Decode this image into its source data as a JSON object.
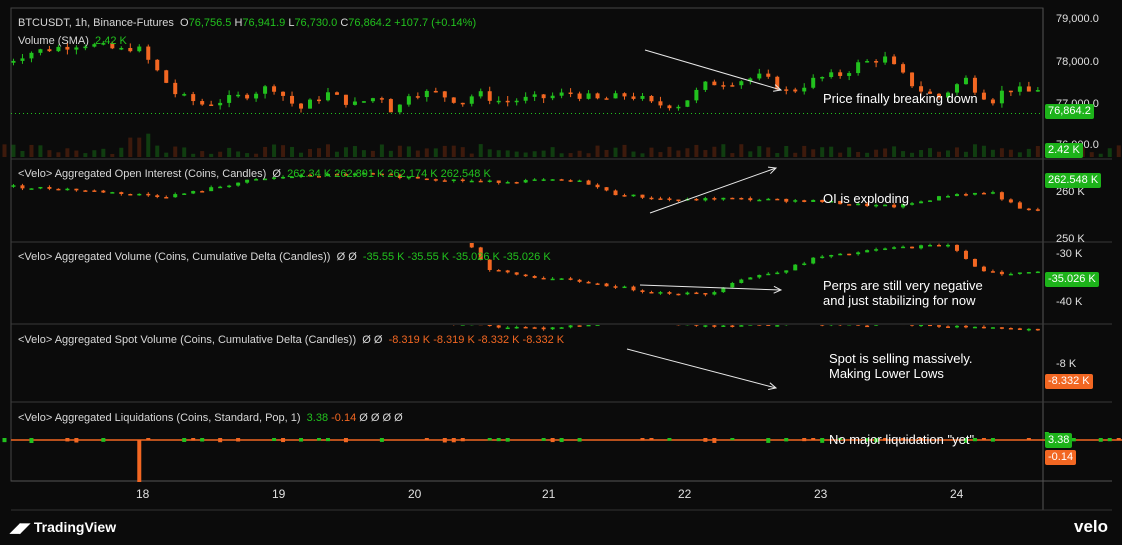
{
  "header": {
    "symbol": "BTCUSDT, 1h, Binance-Futures",
    "o_label": "O",
    "o_value": "76,756.5",
    "h_label": "H",
    "h_value": "76,941.9",
    "l_label": "L",
    "l_value": "76,730.0",
    "c_label": "C",
    "c_value": "76,864.2",
    "change": "+107.7 (+0.14%)",
    "volume_label": "Volume (SMA)",
    "volume_value": "2.42 K"
  },
  "panes": {
    "oi": {
      "title": "<Velo> Aggregated Open Interest (Coins, Candles)",
      "symbol": "Ø",
      "values": [
        "262.34 K",
        "262.891 K",
        "262.174 K",
        "262.548 K"
      ]
    },
    "perp": {
      "title": "<Velo> Aggregated Volume (Coins, Cumulative Delta (Candles))",
      "symbols": "Ø Ø",
      "values": [
        "-35.55 K",
        "-35.55 K",
        "-35.026 K",
        "-35.026 K"
      ]
    },
    "spot": {
      "title": "<Velo> Aggregated Spot Volume (Coins, Cumulative Delta (Candles))",
      "symbols": "Ø Ø",
      "values": [
        "-8.319 K",
        "-8.319 K",
        "-8.332 K",
        "-8.332 K"
      ]
    },
    "liq": {
      "title": "<Velo> Aggregated Liquidations (Coins, Standard, Pop, 1)",
      "v1": "3.38",
      "v2": "-0.14",
      "symbols": "Ø Ø Ø Ø"
    }
  },
  "annotations": {
    "price": "Price finally breaking down",
    "oi": "OI is exploding",
    "perp_line1": "Perps are still very negative",
    "perp_line2": "and just stabilizing for now",
    "spot_line1": "Spot is selling massively.",
    "spot_line2": "Making Lower Lows",
    "liq": "No major liquidation \"yet\""
  },
  "axis": {
    "price_ticks": [
      "79,000.0",
      "78,000.0",
      "77,000.0",
      "76,000.0"
    ],
    "price_tag": "76,864.2",
    "volume_tag": "2.42 K",
    "oi_ticks": [
      "260 K",
      "250 K"
    ],
    "oi_tag": "262.548 K",
    "perp_ticks": [
      "-30 K",
      "-40 K"
    ],
    "perp_tag": "-35.026 K",
    "spot_ticks": [
      "-8 K"
    ],
    "spot_tag": "-8.332 K",
    "liq_tag_pos": "3.38",
    "liq_tag_neg": "-0.14"
  },
  "brand": {
    "left": "TradingView",
    "right": "velo"
  },
  "colors": {
    "up": "#22c11e",
    "down": "#f26722",
    "background": "#0b0b0b",
    "grid": "#2a2a2a"
  },
  "chart_data": [
    {
      "type": "candlestick",
      "title": "BTCUSDT, 1h, Binance-Futures",
      "x_ticks": [
        "18",
        "19",
        "20",
        "21",
        "22",
        "23",
        "24"
      ],
      "ylim": [
        75900,
        79100
      ],
      "last": 76864.2,
      "path_days": [
        0,
        0.2,
        0.4,
        0.6,
        0.9,
        1.0,
        1.3,
        1.5,
        1.8,
        2.0,
        2.2,
        2.4,
        2.6,
        2.8,
        2.9,
        3.0,
        3.2,
        3.4,
        3.5,
        3.7,
        3.8,
        4.0,
        4.2,
        4.4,
        4.6,
        4.7,
        4.8,
        5.0,
        5.2,
        5.4,
        5.6,
        5.8,
        6.0,
        6.2,
        6.3,
        6.5,
        6.7,
        6.8,
        6.9,
        7.0,
        7.1,
        7.2,
        7.3,
        7.4,
        7.6,
        7.7,
        7.85,
        8.0,
        8.15,
        8.3,
        8.5,
        8.65,
        8.8,
        8.95,
        9.1,
        9.2,
        9.25
      ],
      "path_values": [
        77900,
        78150,
        78250,
        78350,
        78200,
        78300,
        77250,
        77050,
        77250,
        77450,
        76950,
        77300,
        77050,
        77250,
        76850,
        77300,
        77300,
        77100,
        77300,
        77100,
        77150,
        77200,
        77300,
        77150,
        77250,
        77200,
        77050,
        77050,
        77500,
        77550,
        77650,
        77300,
        77600,
        77700,
        77900,
        78050,
        77500,
        77300,
        77200,
        77400,
        77600,
        77300,
        77150,
        77400,
        77300,
        77600,
        77550,
        77300,
        77250,
        77550,
        77950,
        77800,
        77700,
        77500,
        77600,
        76850,
        76864
      ]
    },
    {
      "type": "line",
      "title": "<Velo> Aggregated Open Interest (Coins, Candles)",
      "ylim": [
        249000,
        265000
      ],
      "last": 262548,
      "path_days": [
        0,
        0.5,
        1.0,
        1.2,
        1.4,
        1.8,
        2.1,
        2.4,
        2.7,
        3.0,
        3.3,
        3.6,
        4.0,
        4.3,
        4.5,
        4.8,
        5.0,
        5.3,
        5.7,
        6.0,
        6.3,
        6.6,
        7.0,
        7.3,
        7.5,
        7.8,
        8.2,
        8.5,
        8.8,
        8.9,
        9.0,
        9.15,
        9.25
      ],
      "path_values": [
        259800,
        259200,
        258200,
        257800,
        258500,
        260700,
        261600,
        261900,
        262100,
        261500,
        261000,
        260600,
        260900,
        260600,
        258300,
        257500,
        257000,
        257400,
        257100,
        256900,
        256200,
        255800,
        258200,
        258500,
        255300,
        254600,
        254700,
        255000,
        256000,
        256200,
        256500,
        261000,
        262500
      ]
    },
    {
      "type": "line",
      "title": "<Velo> Aggregated Volume (Coins, Cumulative Delta (Candles))",
      "ylim": [
        -44000,
        -28000
      ],
      "last": -35026,
      "path_days": [
        0,
        0.4,
        0.8,
        1.2,
        1.4,
        2.0,
        2.6,
        3.0,
        3.4,
        3.6,
        3.9,
        4.3,
        4.8,
        5.2,
        5.4,
        5.8,
        6.0,
        6.2,
        6.5,
        6.8,
        7.0,
        7.2,
        7.4,
        7.6,
        7.9,
        8.2,
        8.4,
        8.7,
        9.0,
        9.25
      ],
      "path_values": [
        -22000,
        -23000,
        -24000,
        -24500,
        -24800,
        -25500,
        -26000,
        -26200,
        -26800,
        -33500,
        -34800,
        -35800,
        -37800,
        -38200,
        -35600,
        -33200,
        -31000,
        -30500,
        -29300,
        -28800,
        -28500,
        -33800,
        -34100,
        -33900,
        -33600,
        -34400,
        -35600,
        -35400,
        -35200,
        -35026
      ]
    },
    {
      "type": "line",
      "title": "<Velo> Aggregated Spot Volume (Coins, Cumulative Delta (Candles))",
      "ylim": [
        -8400,
        -7200
      ],
      "last": -8332,
      "path_days": [
        0,
        0.5,
        1.0,
        1.5,
        2.0,
        2.5,
        3.0,
        3.3,
        3.6,
        4.0,
        4.3,
        4.6,
        5.0,
        5.3,
        5.6,
        6.0,
        6.3,
        6.5,
        6.7,
        6.9,
        7.0,
        7.2,
        7.4,
        7.6,
        7.9,
        8.2,
        8.5,
        8.8,
        9.0,
        9.1,
        9.25
      ],
      "path_values": [
        -7000,
        -7050,
        -7100,
        -7080,
        -7120,
        -7100,
        -7150,
        -7180,
        -7230,
        -7260,
        -7200,
        -7180,
        -7210,
        -7220,
        -7200,
        -7190,
        -7210,
        -7200,
        -7215,
        -7230,
        -7240,
        -7240,
        -7270,
        -7300,
        -7310,
        -7350,
        -7420,
        -7480,
        -7560,
        -7650,
        -8332
      ]
    }
  ]
}
